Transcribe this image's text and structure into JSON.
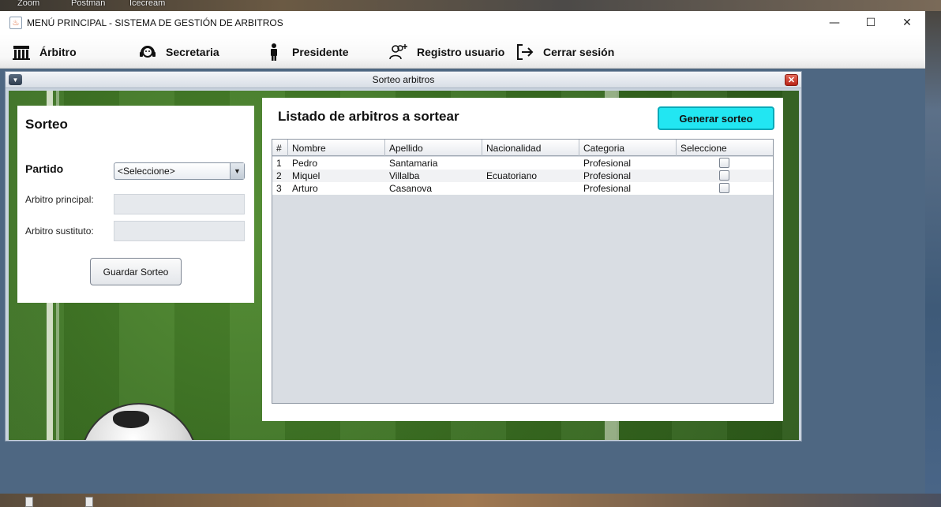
{
  "taskbar": {
    "items": [
      "Zoom",
      "Postman",
      "Icecream"
    ]
  },
  "window": {
    "title": "MENÚ PRINCIPAL - SISTEMA DE GESTIÓN DE ARBITROS",
    "controls": {
      "minimize": "—",
      "maximize": "☐",
      "close": "✕"
    }
  },
  "menu": {
    "items": [
      {
        "label": "Árbitro",
        "icon": "referee-icon"
      },
      {
        "label": "Secretaria",
        "icon": "headset-icon"
      },
      {
        "label": "Presidente",
        "icon": "person-icon"
      },
      {
        "label": "Registro usuario",
        "icon": "add-user-icon"
      },
      {
        "label": "Cerrar sesión",
        "icon": "logout-icon"
      }
    ]
  },
  "internal_frame": {
    "title": "Sorteo arbitros",
    "close_glyph": "✕",
    "menu_glyph": "▼"
  },
  "sorteo": {
    "title": "Sorteo",
    "partido_label": "Partido",
    "partido_selected": "<Seleccione>",
    "arbitro_principal_label": "Arbitro principal:",
    "arbitro_principal_value": "",
    "arbitro_sustituto_label": "Arbitro sustituto:",
    "arbitro_sustituto_value": "",
    "guardar_label": "Guardar Sorteo"
  },
  "listado": {
    "title": "Listado de arbitros a sortear",
    "generar_label": "Generar sorteo",
    "columns": [
      "#",
      "Nombre",
      "Apellido",
      "Nacionalidad",
      "Categoria",
      "Seleccione"
    ],
    "rows": [
      {
        "num": "1",
        "nombre": "Pedro",
        "apellido": "Santamaria",
        "nacionalidad": "",
        "categoria": "Profesional",
        "seleccionado": false
      },
      {
        "num": "2",
        "nombre": "Miquel",
        "apellido": "Villalba",
        "nacionalidad": "Ecuatoriano",
        "categoria": "Profesional",
        "seleccionado": false
      },
      {
        "num": "3",
        "nombre": "Arturo",
        "apellido": "Casanova",
        "nacionalidad": "",
        "categoria": "Profesional",
        "seleccionado": false
      }
    ]
  },
  "colors": {
    "accent_button": "#22e6f2",
    "close_red": "#c8321f"
  }
}
